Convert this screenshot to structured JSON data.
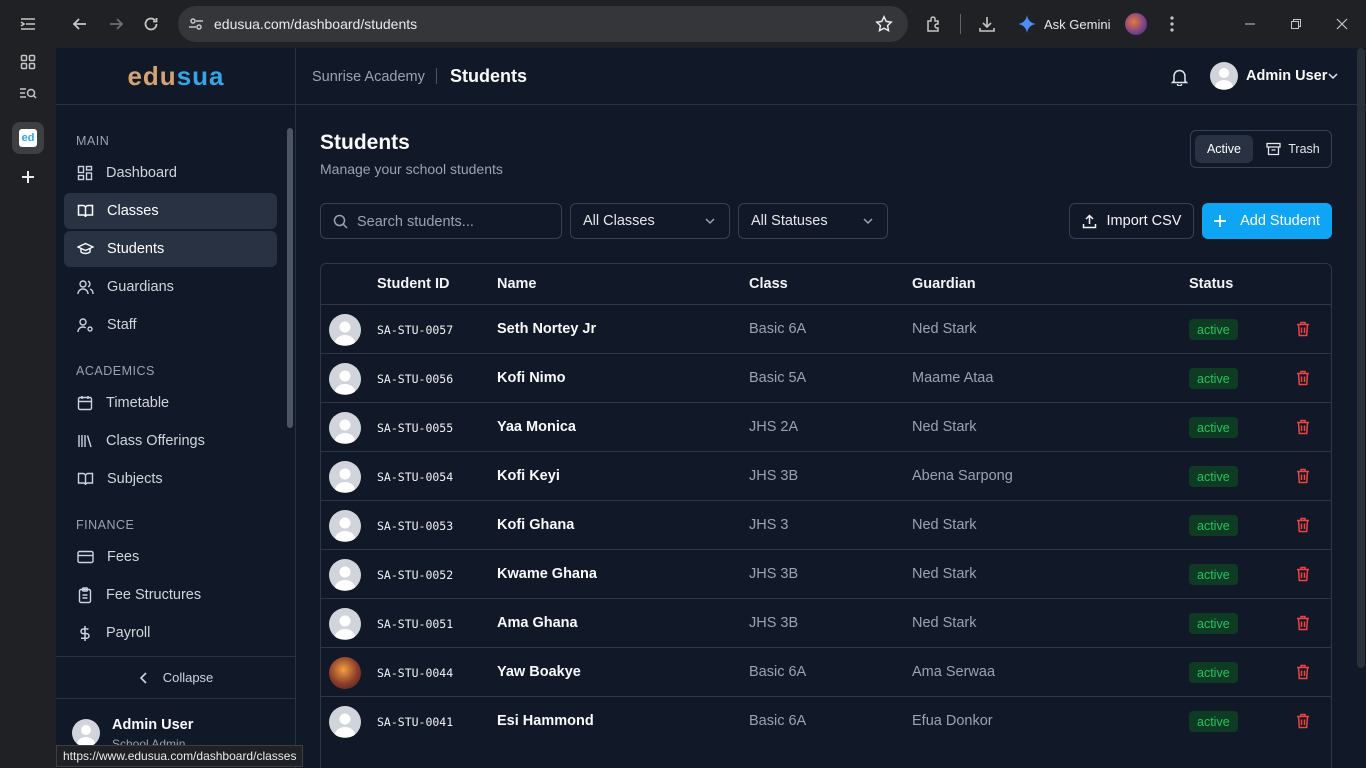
{
  "browser": {
    "url": "edusua.com/dashboard/students",
    "ask_gemini": "Ask Gemini",
    "status_link": "https://www.edusua.com/dashboard/classes",
    "tab_favicon_text": "ed"
  },
  "brand": {
    "part1": "edu",
    "part2": "sua",
    "color1": "#d4a373",
    "color2": "#38a3e6"
  },
  "header": {
    "school": "Sunrise Academy",
    "page": "Students",
    "user_name": "Admin User"
  },
  "sidebar": {
    "main_label": "MAIN",
    "main_items": [
      {
        "label": "Dashboard",
        "icon": "dashboard-icon"
      },
      {
        "label": "Classes",
        "icon": "book-open-icon"
      },
      {
        "label": "Students",
        "icon": "graduation-cap-icon"
      },
      {
        "label": "Guardians",
        "icon": "users-icon"
      },
      {
        "label": "Staff",
        "icon": "user-cog-icon"
      }
    ],
    "academics_label": "ACADEMICS",
    "academics_items": [
      {
        "label": "Timetable",
        "icon": "calendar-icon"
      },
      {
        "label": "Class Offerings",
        "icon": "library-icon"
      },
      {
        "label": "Subjects",
        "icon": "book-icon"
      }
    ],
    "finance_label": "FINANCE",
    "finance_items": [
      {
        "label": "Fees",
        "icon": "credit-card-icon"
      },
      {
        "label": "Fee Structures",
        "icon": "clipboard-icon"
      },
      {
        "label": "Payroll",
        "icon": "dollar-icon"
      }
    ],
    "collapse_label": "Collapse",
    "user_name": "Admin User",
    "user_role": "School Admin"
  },
  "page": {
    "title": "Students",
    "subtitle": "Manage your school students",
    "toggle_active": "Active",
    "toggle_trash": "Trash",
    "search_placeholder": "Search students...",
    "class_filter": "All Classes",
    "status_filter": "All Statuses",
    "import_label": "Import CSV",
    "add_label": "Add Student",
    "accent": "#0ea5f5"
  },
  "table": {
    "headers": {
      "id": "Student ID",
      "name": "Name",
      "class": "Class",
      "guardian": "Guardian",
      "status": "Status"
    },
    "rows": [
      {
        "id": "SA-STU-0057",
        "name": "Seth Nortey Jr",
        "class": "Basic 6A",
        "guardian": "Ned Stark",
        "status": "active"
      },
      {
        "id": "SA-STU-0056",
        "name": "Kofi Nimo",
        "class": "Basic 5A",
        "guardian": "Maame Ataa",
        "status": "active"
      },
      {
        "id": "SA-STU-0055",
        "name": "Yaa Monica",
        "class": "JHS 2A",
        "guardian": "Ned Stark",
        "status": "active"
      },
      {
        "id": "SA-STU-0054",
        "name": "Kofi Keyi",
        "class": "JHS 3B",
        "guardian": "Abena Sarpong",
        "status": "active"
      },
      {
        "id": "SA-STU-0053",
        "name": "Kofi Ghana",
        "class": "JHS 3",
        "guardian": "Ned Stark",
        "status": "active"
      },
      {
        "id": "SA-STU-0052",
        "name": "Kwame Ghana",
        "class": "JHS 3B",
        "guardian": "Ned Stark",
        "status": "active"
      },
      {
        "id": "SA-STU-0051",
        "name": "Ama Ghana",
        "class": "JHS 3B",
        "guardian": "Ned Stark",
        "status": "active"
      },
      {
        "id": "SA-STU-0044",
        "name": "Yaw Boakye",
        "class": "Basic 6A",
        "guardian": "Ama Serwaa",
        "status": "active"
      },
      {
        "id": "SA-STU-0041",
        "name": "Esi Hammond",
        "class": "Basic 6A",
        "guardian": "Efua Donkor",
        "status": "active"
      }
    ]
  }
}
